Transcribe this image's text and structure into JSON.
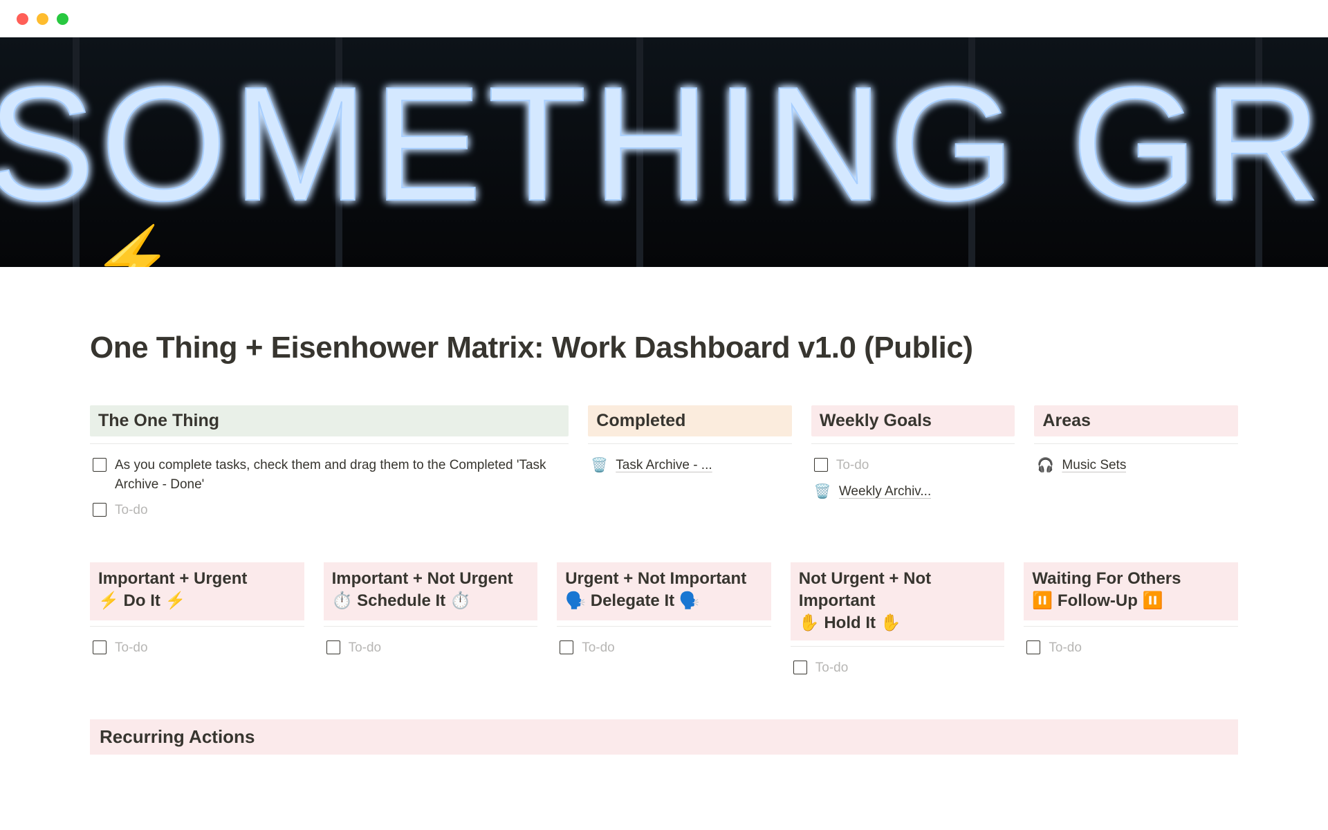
{
  "page": {
    "icon": "⚡",
    "title": "One Thing + Eisenhower Matrix: Work Dashboard v1.0 (Public)"
  },
  "cover": {
    "text": "DO SOMETHING GREAT"
  },
  "row1": {
    "oneThing": {
      "title": "The One Thing",
      "items": [
        {
          "type": "check",
          "text": "As you complete tasks, check them and drag them to the Completed 'Task Archive - Done'"
        },
        {
          "type": "check",
          "text": "To-do",
          "placeholder": true
        }
      ]
    },
    "completed": {
      "title": "Completed",
      "items": [
        {
          "type": "link",
          "emoji": "🗑️",
          "text": "Task Archive - ..."
        }
      ]
    },
    "weekly": {
      "title": "Weekly Goals",
      "items": [
        {
          "type": "check",
          "text": "To-do",
          "placeholder": true
        },
        {
          "type": "link",
          "emoji": "🗑️",
          "text": "Weekly Archiv..."
        }
      ]
    },
    "areas": {
      "title": "Areas",
      "items": [
        {
          "type": "link",
          "emoji": "🎧",
          "text": "Music Sets"
        }
      ]
    }
  },
  "matrix": [
    {
      "title": "Important + Urgent\n⚡ Do It ⚡",
      "todo": "To-do"
    },
    {
      "title": "Important + Not Urgent\n⏱️ Schedule It ⏱️",
      "todo": "To-do"
    },
    {
      "title": "Urgent + Not Important\n🗣️ Delegate It 🗣️",
      "todo": "To-do"
    },
    {
      "title": "Not Urgent + Not Important\n✋ Hold It ✋",
      "todo": "To-do"
    },
    {
      "title": "Waiting For Others\n⏸️ Follow-Up ⏸️",
      "todo": "To-do"
    }
  ],
  "recurring": {
    "title": "Recurring Actions"
  }
}
